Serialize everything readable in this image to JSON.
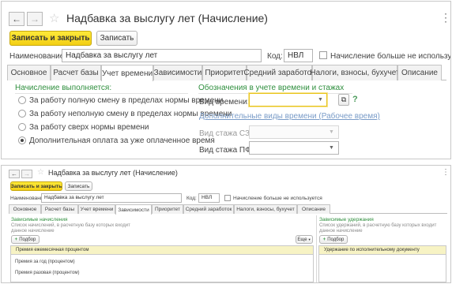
{
  "top": {
    "nav_back": "←",
    "nav_forward": "→",
    "star": "☆",
    "title": "Надбавка за выслугу лет (Начисление)",
    "kebab": "⋮",
    "save_close": "Записать и закрыть",
    "save": "Записать",
    "name_label": "Наименование:",
    "name_value": "Надбавка за выслугу лет",
    "code_label": "Код:",
    "code_value": "НВЛ",
    "unused_label": "Начисление больше не используется",
    "tabs": [
      "Основное",
      "Расчет базы",
      "Учет времени",
      "Зависимости",
      "Приоритет",
      "Средний заработок",
      "Налоги, взносы, бухучет",
      "Описание"
    ],
    "left_section_title": "Начисление выполняется:",
    "radio_1": "За работу полную смену в пределах нормы времени",
    "radio_2": "За работу неполную смену в пределах нормы времени",
    "radio_3": "За работу сверх нормы времени",
    "radio_4": "Дополнительная оплата за уже оплаченное время",
    "right_section_title": "Обозначения в учете времени и стажах",
    "time_kind_label": "Вид времени:",
    "time_kind_value": "",
    "help": "?",
    "extra_link": "Дополнительные виды времени (Рабочее время)",
    "szv_label": "Вид стажа СЗВ:",
    "pfr_label": "Вид стажа ПФР:"
  },
  "bottom": {
    "nav_back": "←",
    "nav_forward": "→",
    "star": "☆",
    "title": "Надбавка за выслугу лет (Начисление)",
    "kebab": "⋮",
    "save_close": "Записать и закрыть",
    "save": "Записать",
    "name_label": "Наименование:",
    "name_value": "Надбавка за выслугу лет",
    "code_label": "Код:",
    "code_value": "НВЛ",
    "unused_label": "Начисление больше не используется",
    "tabs": [
      "Основное",
      "Расчет базы",
      "Учет времени",
      "Зависимости",
      "Приоритет",
      "Средний заработок",
      "Налоги, взносы, бухучет",
      "Описание"
    ],
    "dep_title": "Зависимые начисления",
    "dep_desc": "Список начислений, в расчетную базу которых входит данное начисление",
    "pick": "Подбор",
    "more": "Еще",
    "dep_rows": [
      "Премия ежемесячная процентом",
      "Премия за год (процентом)",
      "Премия разовая (процентом)"
    ],
    "ded_title": "Зависимые удержания",
    "ded_desc": "Список удержаний, в расчетную базу которых входит данное начисление",
    "ded_rows": [
      "Удержание по исполнительному документу"
    ]
  }
}
